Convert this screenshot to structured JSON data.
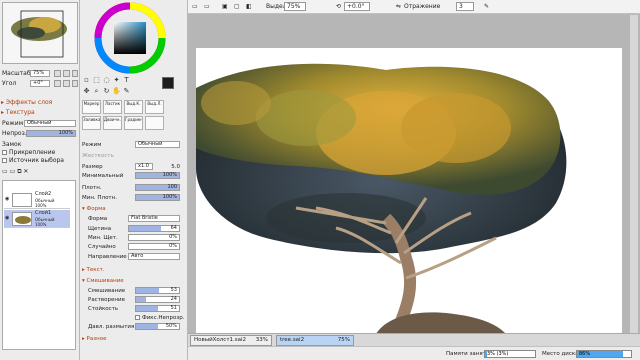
{
  "navigator": {
    "scale_label": "Масштаб",
    "scale_value": "75%",
    "angle_label": "Угол",
    "angle_value": "+0°"
  },
  "sections": {
    "layer_effects": "Эффекты слоя",
    "texture": "Текстура"
  },
  "layer_props": {
    "mode_label": "Режим",
    "mode_value": "Обычный",
    "opacity_label": "Непроз.",
    "opacity_value": "100%",
    "lock_label": "Замок",
    "clipping_label": "Прикрепление",
    "source_label": "Источник выбора"
  },
  "layers": [
    {
      "name": "Слой2",
      "mode": "Обычный",
      "opacity": "100%",
      "selected": false
    },
    {
      "name": "Слой1",
      "mode": "Обычный",
      "opacity": "100%",
      "selected": true
    }
  ],
  "brushes": {
    "row1": [
      "Маркер",
      "Ластик",
      "Выд.К.",
      "Выд.Л."
    ],
    "row2": [
      "Заливка",
      "Двоичн...",
      "Градиент",
      ""
    ]
  },
  "tool": {
    "mode_label": "Режим",
    "mode_value": "Обычный",
    "size_label": "Размер",
    "size_mult": "x1.0",
    "size_value": "5.0",
    "min_size_label": "Минимальный",
    "min_size_value": "100%",
    "density_label": "Плотн.",
    "density_value": "100",
    "min_density_label": "Мин. Плотн.",
    "min_density_value": "100%",
    "faded_label": "Жесткость",
    "shape_section": "Форма",
    "shape_label": "Форма",
    "shape_value": "Flat Bristle",
    "bristle_label": "Щетина",
    "bristle_value": "64",
    "min_bristle_label": "Мин. Щет.",
    "min_bristle_value": "0%",
    "random_label": "Случайно",
    "random_value": "0%",
    "direction_label": "Направление",
    "direction_value": "Авто",
    "text_section": "Текст.",
    "blend_section": "Смешивание",
    "blend_label": "Смешивание",
    "blend_value": "53",
    "dilution_label": "Растворение",
    "dilution_value": "24",
    "persistence_label": "Стойкость",
    "persistence_value": "51",
    "fix_label": "Фикс.Непрозр.",
    "blur_label": "Давл. размытия",
    "blur_value": "50%",
    "misc_section": "Разное"
  },
  "toolbar": {
    "selection_label": "Выделение",
    "zoom_value": "75%",
    "angle_value": "+0.0°",
    "flip_label": "Отражение",
    "flip_value": "3"
  },
  "tabs": [
    {
      "name": "НовыйХолст1.sai2",
      "zoom": "33%",
      "active": false
    },
    {
      "name": "tree.sai2",
      "zoom": "75%",
      "active": true
    }
  ],
  "status": {
    "memory_label": "Памяти занято",
    "memory_value": "3% (3%)",
    "memory_fraction": 0.03,
    "disk_label": "Место диска",
    "disk_value": "86%",
    "disk_fraction": 0.86
  },
  "colors": {
    "accent": "#4fa7f0",
    "section": "#b04010",
    "selection": "#b9c7ee"
  }
}
